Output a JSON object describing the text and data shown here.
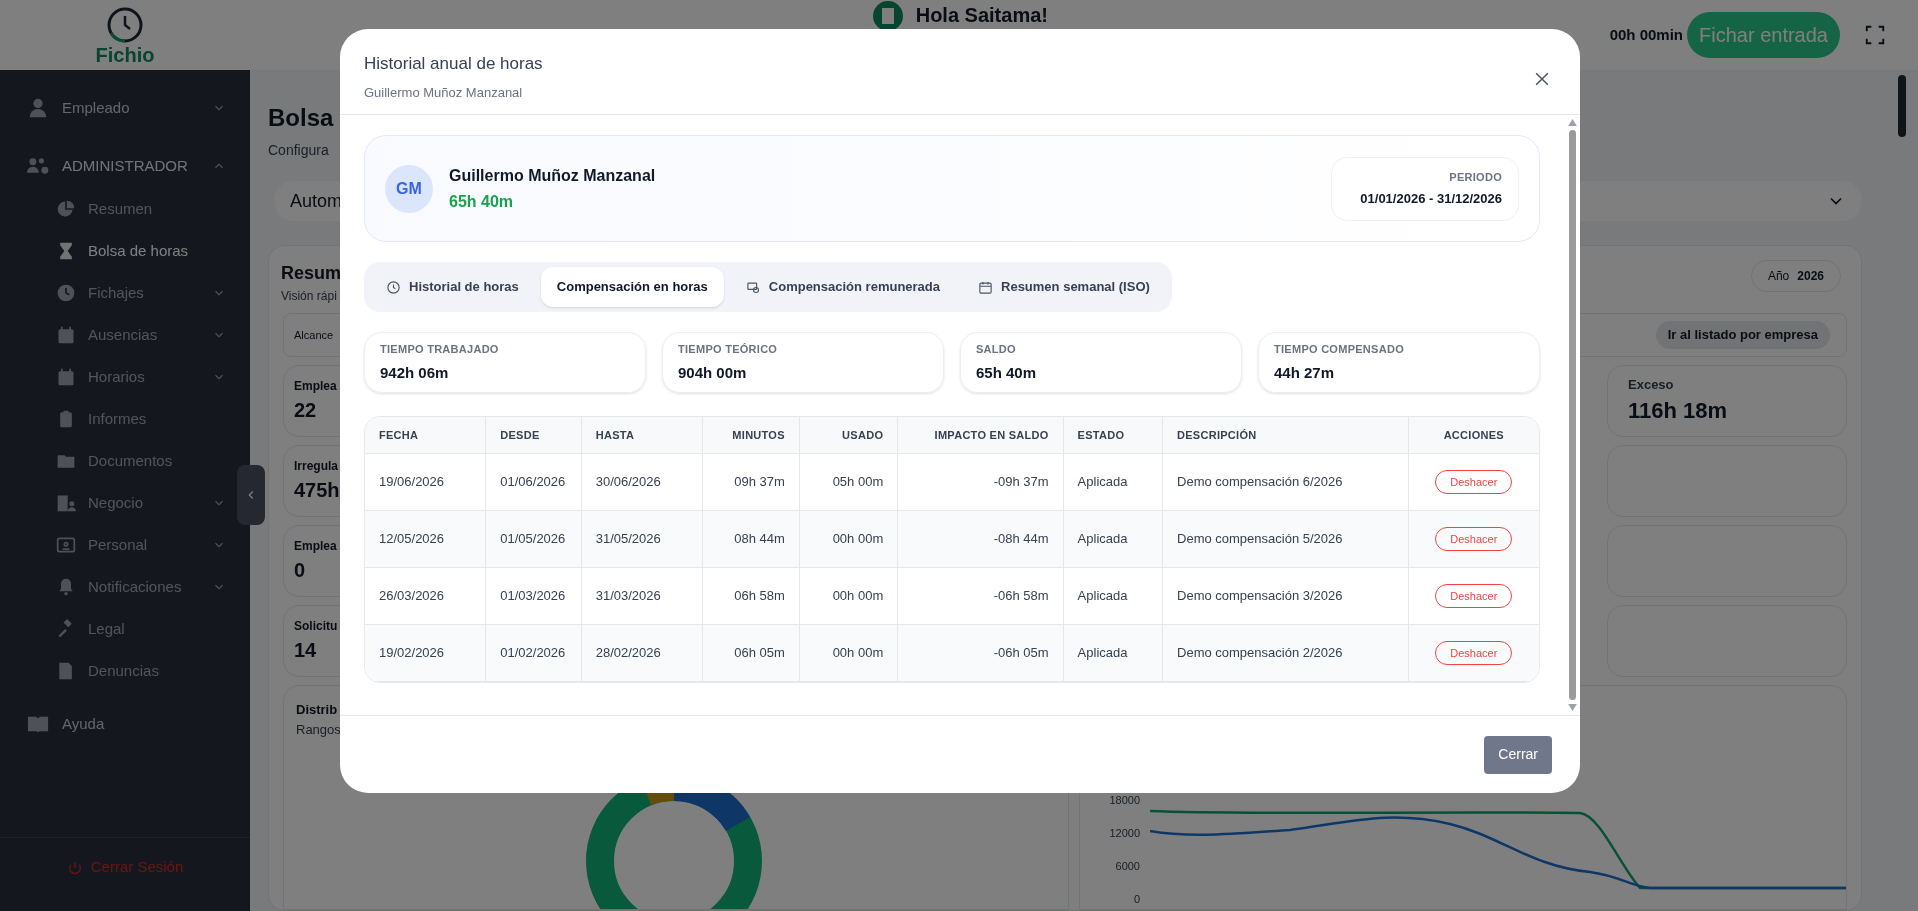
{
  "top_bar": {
    "logo": "Fichio",
    "greeting": "Hola Saitama!",
    "timer": "00h 00min",
    "clock_in_button": "Fichar entrada"
  },
  "sidebar": {
    "sections": [
      {
        "label": "Empleado",
        "has_submenu": true,
        "expanded": false
      },
      {
        "label": "ADMINISTRADOR",
        "has_submenu": true,
        "expanded": true,
        "children": [
          {
            "label": "Resumen",
            "selected": false,
            "has_submenu": false
          },
          {
            "label": "Bolsa de horas",
            "selected": true,
            "has_submenu": false
          },
          {
            "label": "Fichajes",
            "selected": false,
            "has_submenu": true
          },
          {
            "label": "Ausencias",
            "selected": false,
            "has_submenu": true
          },
          {
            "label": "Horarios",
            "selected": false,
            "has_submenu": true
          },
          {
            "label": "Informes",
            "selected": false,
            "has_submenu": false
          },
          {
            "label": "Documentos",
            "selected": false,
            "has_submenu": false
          },
          {
            "label": "Negocio",
            "selected": false,
            "has_submenu": true
          },
          {
            "label": "Personal",
            "selected": false,
            "has_submenu": true
          },
          {
            "label": "Notificaciones",
            "selected": false,
            "has_submenu": true
          },
          {
            "label": "Legal",
            "selected": false,
            "has_submenu": false
          },
          {
            "label": "Denuncias",
            "selected": false,
            "has_submenu": false
          }
        ]
      },
      {
        "label": "Ayuda",
        "has_submenu": false,
        "expanded": false
      }
    ],
    "logout": "Cerrar Sesión"
  },
  "page": {
    "title": "Bolsa",
    "subtitle": "Configura",
    "mode_select": "Autom",
    "summary": {
      "title": "Resum",
      "subtitle": "Visión rápi",
      "year_label": "Año",
      "year": "2026",
      "scope_label": "Alcance",
      "company_list_link": "Ir al listado por empresa",
      "left_stats": [
        {
          "label": "Emplea",
          "value": "22"
        },
        {
          "label": "Irregula",
          "value": "475h"
        },
        {
          "label": "Emplea",
          "value": "0"
        },
        {
          "label": "Solicitu",
          "value": "14"
        }
      ],
      "right_stats": [
        {
          "label": "Exceso",
          "value": "116h 18m"
        }
      ]
    },
    "distribution": {
      "title": "Distrib",
      "subtitle": "Rangos"
    },
    "trend_chart": {
      "axis_labels": [
        "18000",
        "12000",
        "6000",
        "0"
      ]
    }
  },
  "dialog": {
    "title": "Historial anual de horas",
    "subtitle": "Guillermo Muñoz Manzanal",
    "employee": {
      "initials": "GM",
      "name": "Guillermo Muñoz Manzanal",
      "balance": "65h 40m",
      "period_label": "PERIODO",
      "period": "01/01/2026 - 31/12/2026"
    },
    "tabs": [
      {
        "label": "Historial de horas",
        "selected": false
      },
      {
        "label": "Compensación en horas",
        "selected": true
      },
      {
        "label": "Compensación remunerada",
        "selected": false
      },
      {
        "label": "Resumen semanal (ISO)",
        "selected": false
      }
    ],
    "stats": [
      {
        "label": "TIEMPO TRABAJADO",
        "value": "942h 06m"
      },
      {
        "label": "TIEMPO TEÓRICO",
        "value": "904h 00m"
      },
      {
        "label": "SALDO",
        "value": "65h 40m"
      },
      {
        "label": "TIEMPO COMPENSADO",
        "value": "44h 27m"
      }
    ],
    "table": {
      "columns": [
        "FECHA",
        "DESDE",
        "HASTA",
        "MINUTOS",
        "USADO",
        "IMPACTO EN SALDO",
        "ESTADO",
        "DESCRIPCIÓN",
        "ACCIONES"
      ],
      "rows": [
        {
          "cells": [
            "19/06/2026",
            "01/06/2026",
            "30/06/2026",
            "09h 37m",
            "05h 00m",
            "-09h 37m",
            "Aplicada",
            "Demo compensación 6/2026"
          ],
          "action": "Deshacer"
        },
        {
          "cells": [
            "12/05/2026",
            "01/05/2026",
            "31/05/2026",
            "08h 44m",
            "00h 00m",
            "-08h 44m",
            "Aplicada",
            "Demo compensación 5/2026"
          ],
          "action": "Deshacer"
        },
        {
          "cells": [
            "26/03/2026",
            "01/03/2026",
            "31/03/2026",
            "06h 58m",
            "00h 00m",
            "-06h 58m",
            "Aplicada",
            "Demo compensación 3/2026"
          ],
          "action": "Deshacer"
        },
        {
          "cells": [
            "19/02/2026",
            "01/02/2026",
            "28/02/2026",
            "06h 05m",
            "00h 00m",
            "-06h 05m",
            "Aplicada",
            "Demo compensación 2/2026"
          ],
          "action": "Deshacer"
        }
      ]
    },
    "close_button": "Cerrar"
  }
}
